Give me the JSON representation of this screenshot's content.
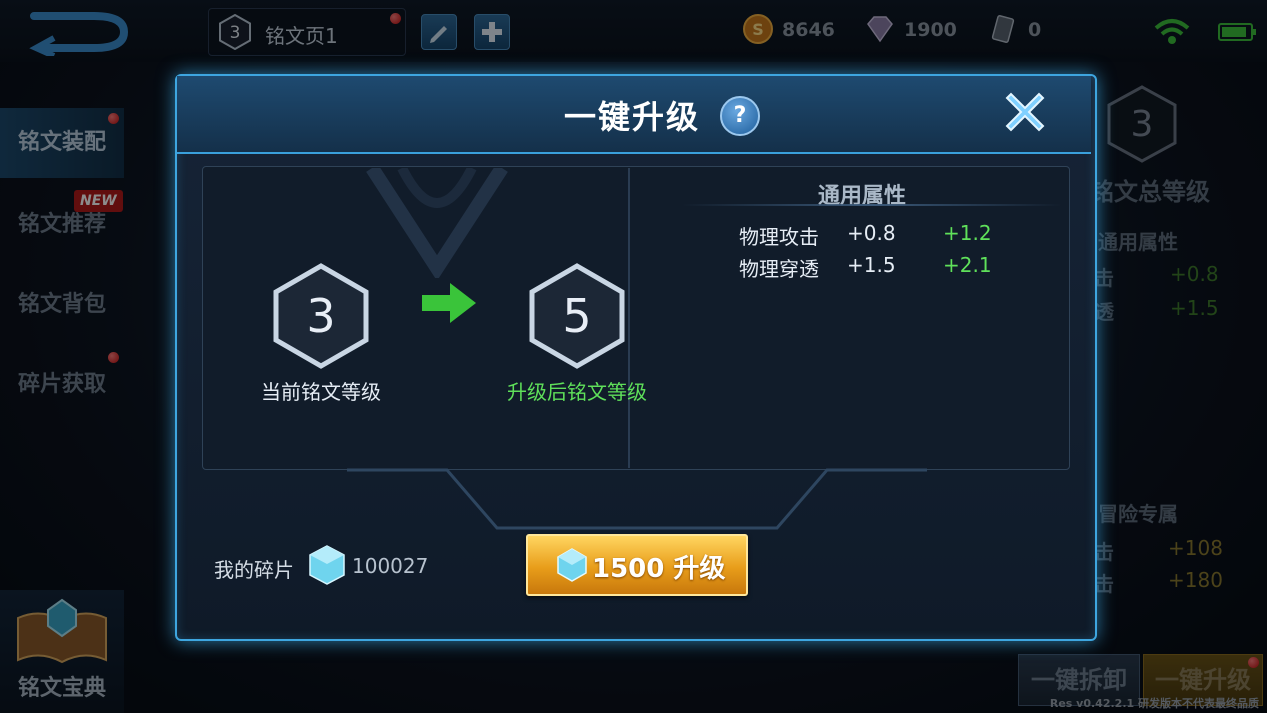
{
  "topbar": {
    "page_level": "3",
    "page_name": "铭文页1",
    "gold": "8646",
    "diamonds": "1900",
    "vouchers": "0"
  },
  "sidebar": {
    "items": [
      {
        "label": "铭文装配"
      },
      {
        "label": "铭文推荐",
        "badge": "NEW"
      },
      {
        "label": "铭文背包"
      },
      {
        "label": "碎片获取"
      }
    ],
    "codex_label": "铭文宝典"
  },
  "background_panel": {
    "total_level_value": "3",
    "total_level_label": "铭文总等级",
    "general_attr_label": "通用属性",
    "attr_row1_name": "击",
    "attr_row1_value": "+0.8",
    "attr_row2_name": "透",
    "attr_row2_value": "+1.5",
    "adventure_label": "冒险专属",
    "adv_row1_name": "击",
    "adv_row1_value": "+108",
    "adv_row2_name": "击",
    "adv_row2_value": "+180"
  },
  "bottom_buttons": {
    "dismantle_label": "一键拆卸",
    "upgrade_label": "一键升级"
  },
  "version_text": "Res v0.42.2.1 研发版本不代表最终品质",
  "modal": {
    "title": "一键升级",
    "help": "?",
    "current_level": "3",
    "current_level_label": "当前铭文等级",
    "new_level": "5",
    "new_level_label": "升级后铭文等级",
    "stats_title": "通用属性",
    "stats": [
      {
        "name": "物理攻击",
        "current": "+0.8",
        "new": "+1.2"
      },
      {
        "name": "物理穿透",
        "current": "+1.5",
        "new": "+2.1"
      }
    ],
    "fragments_label": "我的碎片",
    "fragments_value": "100027",
    "upgrade_button_label": "1500 升级"
  },
  "colors": {
    "accent_blue": "#3ea6e0",
    "green": "#5fe05a",
    "gold_button": "#e89d1a"
  }
}
